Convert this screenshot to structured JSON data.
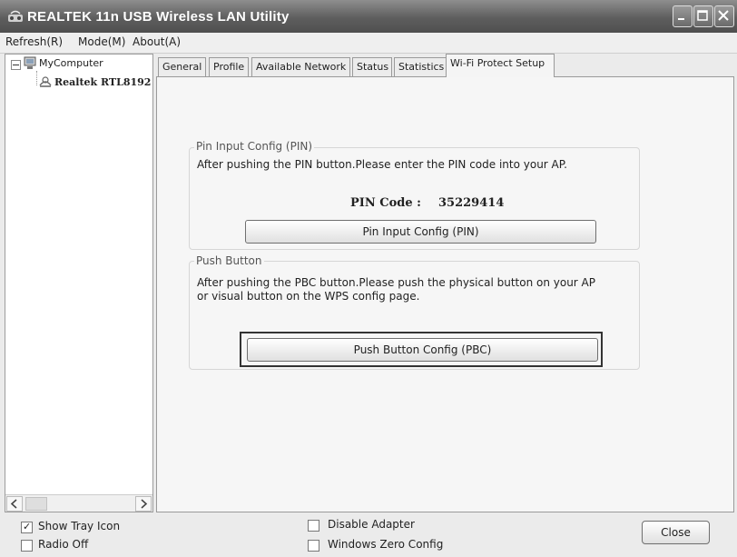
{
  "window": {
    "title": "REALTEK 11n USB Wireless LAN Utility"
  },
  "menu": {
    "items": [
      "Refresh(R)",
      "Mode(M)",
      "About(A)"
    ]
  },
  "tree": {
    "root": "MyComputer",
    "adapter": "Realtek RTL8192"
  },
  "tabs": [
    {
      "label": "General",
      "active": false
    },
    {
      "label": "Profile",
      "active": false
    },
    {
      "label": "Available Network",
      "active": false
    },
    {
      "label": "Status",
      "active": false
    },
    {
      "label": "Statistics",
      "active": false
    },
    {
      "label": "Wi-Fi Protect Setup",
      "active": true
    }
  ],
  "pin_group": {
    "title": "Pin Input Config (PIN)",
    "description": "After pushing the PIN button.Please enter the PIN code into your AP.",
    "pin_label": "PIN Code :",
    "pin_value": "35229414",
    "button": "Pin Input Config (PIN)"
  },
  "pbc_group": {
    "title": "Push Button",
    "description_line1": "After pushing the PBC button.Please push the physical button on your AP",
    "description_line2": "or visual button on the WPS config page.",
    "button": "Push Button Config (PBC)"
  },
  "footer": {
    "show_tray_icon": {
      "label": "Show Tray Icon",
      "checked": true
    },
    "radio_off": {
      "label": "Radio Off",
      "checked": false
    },
    "disable_adapter": {
      "label": "Disable Adapter",
      "checked": false
    },
    "windows_zero_config": {
      "label": "Windows Zero Config",
      "checked": false
    },
    "close_button": "Close"
  }
}
